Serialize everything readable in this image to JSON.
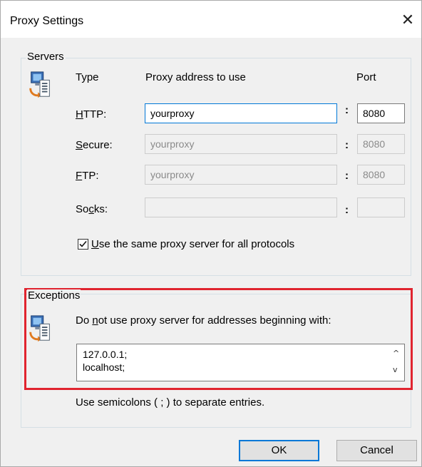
{
  "window": {
    "title": "Proxy Settings",
    "close_glyph": "✕"
  },
  "servers": {
    "group_label": "Servers",
    "icon": "network-computer-icon",
    "col_type": "Type",
    "col_address": "Proxy address to use",
    "col_port": "Port",
    "rows": [
      {
        "label_pre": "",
        "label_ul": "H",
        "label_post": "TTP:",
        "address": "yourproxy",
        "port": "8080",
        "enabled": true
      },
      {
        "label_pre": "",
        "label_ul": "S",
        "label_post": "ecure:",
        "address": "yourproxy",
        "port": "8080",
        "enabled": false
      },
      {
        "label_pre": "",
        "label_ul": "F",
        "label_post": "TP:",
        "address": "yourproxy",
        "port": "8080",
        "enabled": false
      },
      {
        "label_pre": "So",
        "label_ul": "c",
        "label_post": "ks:",
        "address": "",
        "port": "",
        "enabled": false
      }
    ],
    "colon": ":",
    "same_proxy": {
      "ul": "U",
      "rest": "se the same proxy server for all protocols",
      "checked": true
    }
  },
  "exceptions": {
    "group_label": "Exceptions",
    "icon": "network-computer-icon",
    "desc_pre": "Do ",
    "desc_ul": "n",
    "desc_post": "ot use proxy server for addresses beginning with:",
    "entries_line1": "127.0.0.1;",
    "entries_line2": "localhost;",
    "scroll_up": "^",
    "scroll_down": "v",
    "hint": "Use semicolons ( ; ) to separate entries.",
    "highlight_color": "#e0242f"
  },
  "buttons": {
    "ok": "OK",
    "cancel": "Cancel"
  }
}
